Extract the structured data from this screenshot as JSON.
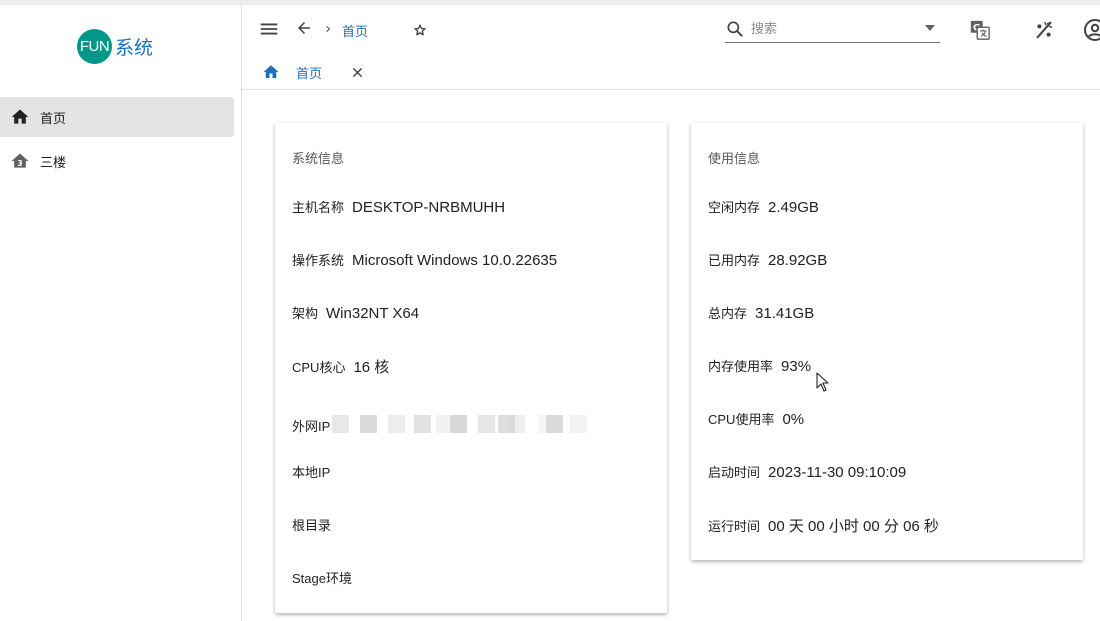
{
  "app": {
    "logo_badge": "FUN",
    "logo_text": "系统"
  },
  "sidebar": {
    "items": [
      {
        "label": "首页",
        "icon": "home-icon",
        "active": true
      },
      {
        "label": "三楼",
        "icon": "floor-3-icon",
        "active": false
      }
    ]
  },
  "header": {
    "breadcrumb": "首页",
    "search": {
      "placeholder": "搜索",
      "value": ""
    },
    "tabs": [
      {
        "label": "首页"
      }
    ]
  },
  "system_card": {
    "title": "系统信息",
    "rows": [
      {
        "label": "主机名称",
        "value": "DESKTOP-NRBMUHH"
      },
      {
        "label": "操作系统",
        "value": "Microsoft Windows 10.0.22635"
      },
      {
        "label": "架构",
        "value": "Win32NT X64"
      },
      {
        "label": "CPU核心",
        "value": "16 核"
      },
      {
        "label": "外网IP",
        "value": ""
      },
      {
        "label": "本地IP",
        "value": ""
      },
      {
        "label": "根目录",
        "value": ""
      },
      {
        "label": "Stage环境",
        "value": ""
      }
    ]
  },
  "usage_card": {
    "title": "使用信息",
    "rows": [
      {
        "label": "空闲内存",
        "value": "2.49GB"
      },
      {
        "label": "已用内存",
        "value": "28.92GB"
      },
      {
        "label": "总内存",
        "value": "31.41GB"
      },
      {
        "label": "内存使用率",
        "value": "93%"
      },
      {
        "label": "CPU使用率",
        "value": "0%"
      },
      {
        "label": "启动时间",
        "value": "2023-11-30 09:10:09"
      },
      {
        "label": "运行时间",
        "value": "00 天 00 小时 00 分 06 秒"
      }
    ]
  },
  "colors": {
    "accent": "#1e6fbf",
    "logo_badge": "#009688",
    "active_nav": "#e3e3e3"
  }
}
